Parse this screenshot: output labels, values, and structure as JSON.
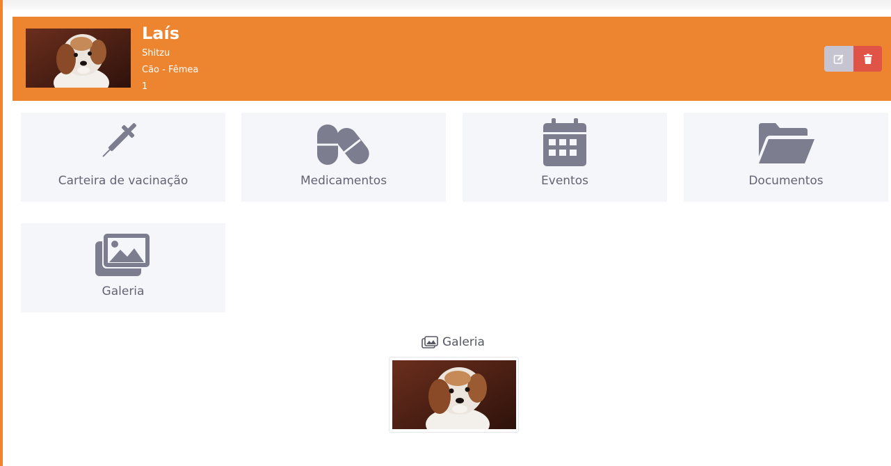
{
  "pet": {
    "name": "Laís",
    "breed": "Shitzu",
    "species_sex": "Cão - Fêmea",
    "age": "1"
  },
  "actions": {
    "edit_icon": "edit-icon",
    "delete_icon": "trash-icon"
  },
  "menu_tiles": [
    {
      "label": "Carteira de vacinação",
      "icon": "syringe-icon"
    },
    {
      "label": "Medicamentos",
      "icon": "pills-icon"
    },
    {
      "label": "Eventos",
      "icon": "calendar-icon"
    },
    {
      "label": "Documentos",
      "icon": "folder-open-icon"
    },
    {
      "label": "Galeria",
      "icon": "images-icon"
    }
  ],
  "gallery": {
    "title": "Galeria",
    "icon": "images-icon"
  },
  "colors": {
    "header": "#ed842f",
    "edit_button": "#c6c4d1",
    "delete_button": "#e05447",
    "tile_background": "#f5f6fa",
    "icon": "#7c7e8f"
  }
}
